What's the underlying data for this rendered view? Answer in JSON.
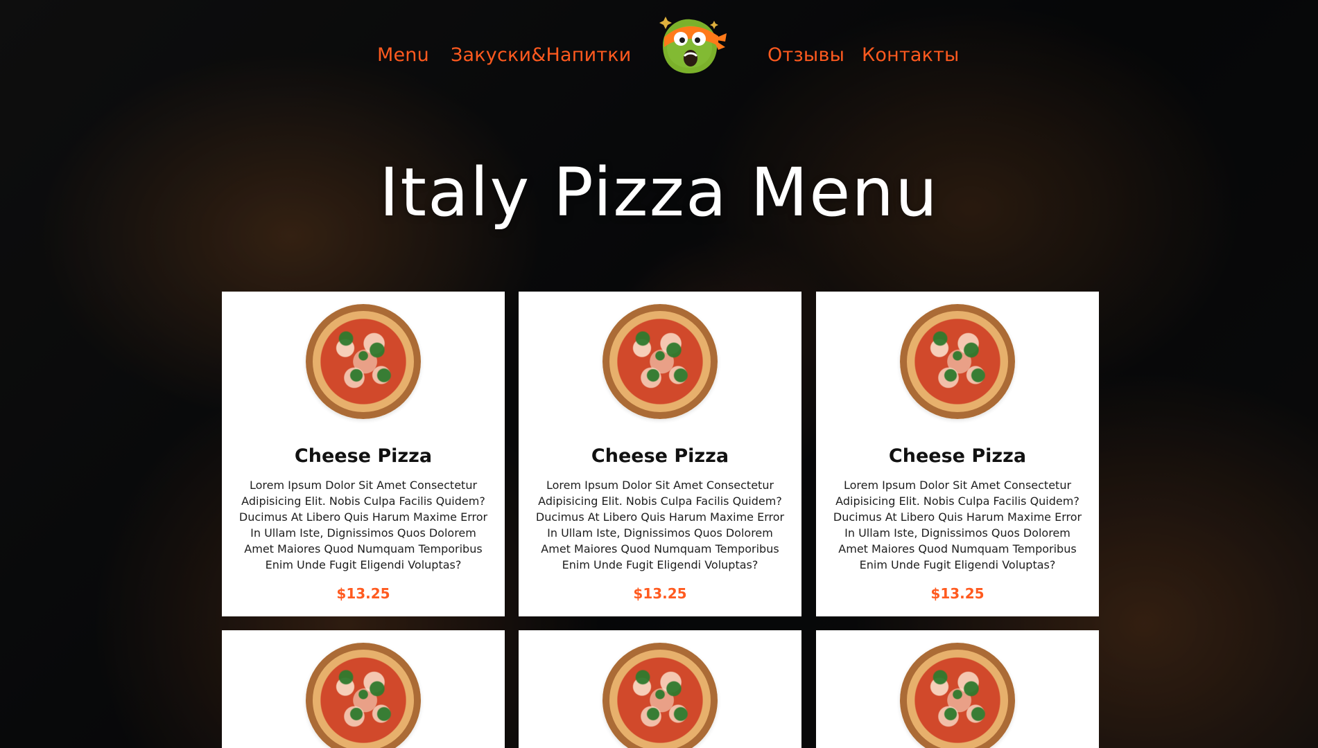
{
  "theme": {
    "accent_color": "#ff5a1f",
    "hero_text_color": "#ffffff",
    "card_bg_color": "#ffffff"
  },
  "nav": {
    "items": [
      {
        "label": "Menu"
      },
      {
        "label": "Закуски&Напитки"
      },
      {
        "label": "Отзывы"
      },
      {
        "label": "Контакты"
      }
    ],
    "logo": {
      "icon": "turtle-mascot-icon"
    }
  },
  "hero": {
    "title": "Italy Pizza Menu"
  },
  "menu": {
    "cards": [
      {
        "title": "Cheese Pizza",
        "desc": "Lorem Ipsum Dolor Sit Amet Consectetur Adipisicing Elit. Nobis Culpa Facilis Quidem? Ducimus At Libero Quis Harum Maxime Error In Ullam Iste, Dignissimos Quos Dolorem Amet Maiores Quod Numquam Temporibus Enim Unde Fugit Eligendi Voluptas?",
        "price": "$13.25",
        "image_icon": "pizza-icon"
      },
      {
        "title": "Cheese Pizza",
        "desc": "Lorem Ipsum Dolor Sit Amet Consectetur Adipisicing Elit. Nobis Culpa Facilis Quidem? Ducimus At Libero Quis Harum Maxime Error In Ullam Iste, Dignissimos Quos Dolorem Amet Maiores Quod Numquam Temporibus Enim Unde Fugit Eligendi Voluptas?",
        "price": "$13.25",
        "image_icon": "pizza-icon"
      },
      {
        "title": "Cheese Pizza",
        "desc": "Lorem Ipsum Dolor Sit Amet Consectetur Adipisicing Elit. Nobis Culpa Facilis Quidem? Ducimus At Libero Quis Harum Maxime Error In Ullam Iste, Dignissimos Quos Dolorem Amet Maiores Quod Numquam Temporibus Enim Unde Fugit Eligendi Voluptas?",
        "price": "$13.25",
        "image_icon": "pizza-icon"
      },
      {
        "image_icon": "pizza-icon"
      },
      {
        "image_icon": "pizza-icon"
      },
      {
        "image_icon": "pizza-icon"
      }
    ]
  }
}
